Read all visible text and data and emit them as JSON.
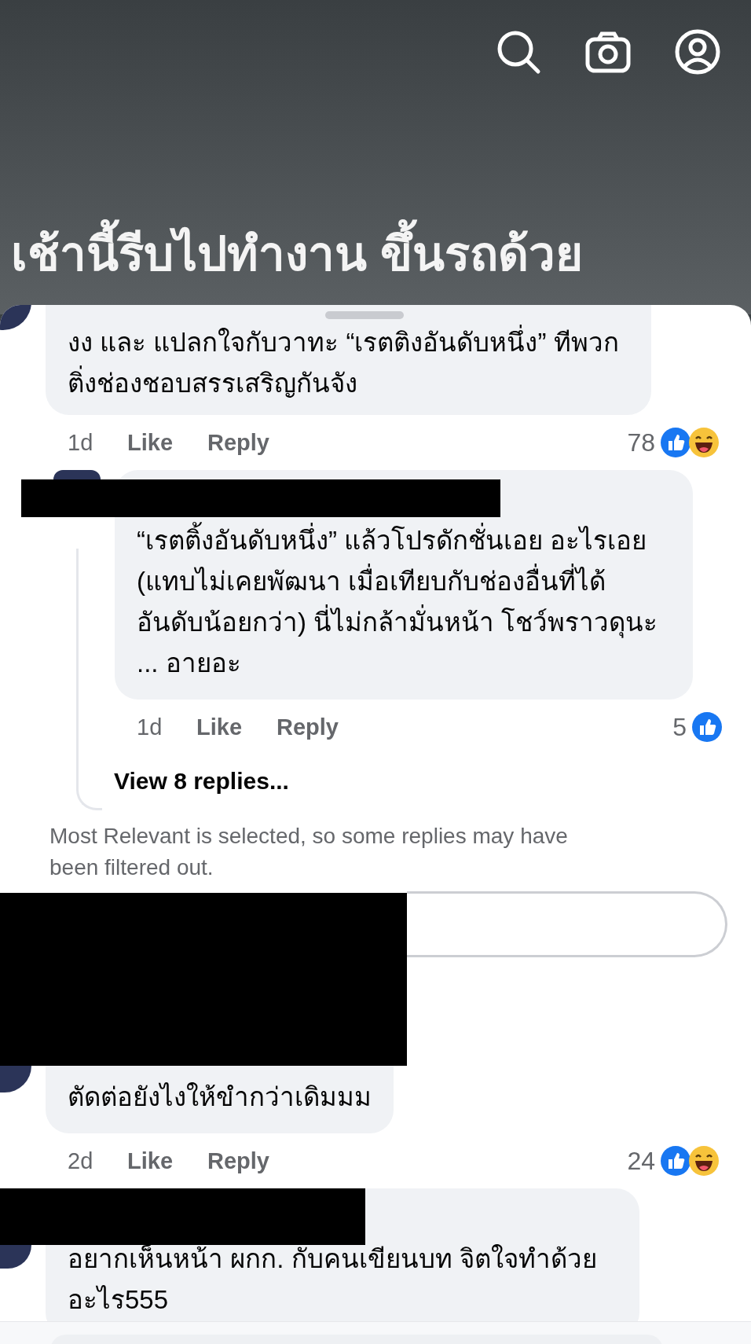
{
  "header": {
    "title": "เช้านี้รีบไปทำงาน ขึ้นรถด้วย"
  },
  "comments": [
    {
      "kind": "comment",
      "author_redacted": false,
      "text": "งง และ แปลกใจกับวาทะ “เรตติงอันดับหนึ่ง” ทีพวก ติ่งช่องชอบสรรเสริญกันจัง",
      "time": "1d",
      "like": "Like",
      "reply": "Reply",
      "count": "78",
      "reactions": [
        {
          "kind": "like"
        },
        {
          "kind": "haha"
        }
      ]
    },
    {
      "kind": "reply",
      "author_redacted": true,
      "text": "“เรตติ้งอันดับหนึ่ง” แล้วโปรดักชั่นเอย อะไรเอย (แทบไม่เคยพัฒนา เมื่อเทียบกับช่องอื่นที่ได้ อันดับน้อยกว่า) นี่ไม่กล้ามั่นหน้า โชว์พราวดุนะ ... อายอะ",
      "time": "1d",
      "like": "Like",
      "reply": "Reply",
      "count": "5",
      "reactions": [
        {
          "kind": "like"
        }
      ]
    },
    {
      "kind": "view_more",
      "text": "View 8 replies..."
    },
    {
      "kind": "note",
      "text": "Most Relevant is selected, so some replies may have been filtered out."
    },
    {
      "kind": "reply_field",
      "redacted": true
    },
    {
      "kind": "comment",
      "author_redacted": true,
      "text": "ตัดต่อยังไงให้ขำกว่าเดิมมม",
      "time": "2d",
      "like": "Like",
      "reply": "Reply",
      "count": "24",
      "reactions": [
        {
          "kind": "like"
        },
        {
          "kind": "haha"
        }
      ]
    },
    {
      "kind": "comment",
      "author_redacted": true,
      "text": "อยากเห็นหน้า ผกก. กับคนเขียนบท จิตใจทำด้วย อะไร555"
    }
  ]
}
